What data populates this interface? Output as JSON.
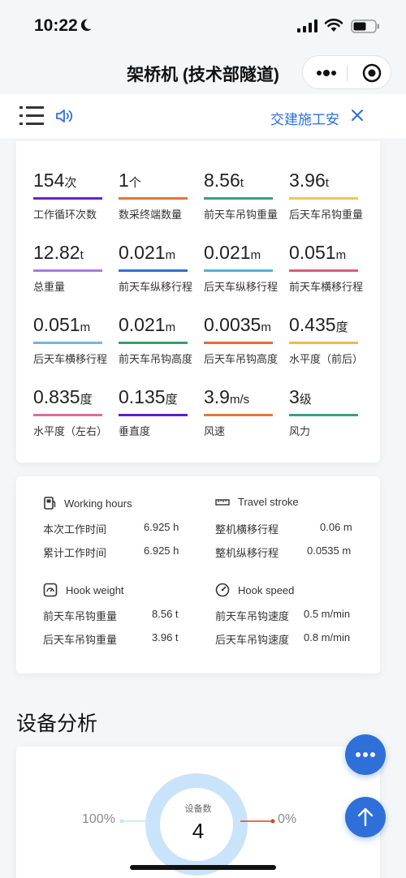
{
  "status_bar": {
    "time": "10:22"
  },
  "nav": {
    "title": "架桥机 (技术部隧道)"
  },
  "notice": {
    "text": "交建施工安"
  },
  "stats": [
    {
      "value": "154",
      "unit": "次",
      "label": "工作循环次数",
      "color": "#6a1fd1"
    },
    {
      "value": "1",
      "unit": "个",
      "label": "数采终端数量",
      "color": "#e0743a"
    },
    {
      "value": "8.56",
      "unit": "t",
      "label": "前天车吊钩重量",
      "color": "#3a9e7e"
    },
    {
      "value": "3.96",
      "unit": "t",
      "label": "后天车吊钩重量",
      "color": "#f2c84b"
    },
    {
      "value": "12.82",
      "unit": "t",
      "label": "总重量",
      "color": "#a77be0"
    },
    {
      "value": "0.021",
      "unit": "m",
      "label": "前天车纵移行程",
      "color": "#2f6fd8"
    },
    {
      "value": "0.021",
      "unit": "m",
      "label": "后天车纵移行程",
      "color": "#4fb3d9"
    },
    {
      "value": "0.051",
      "unit": "m",
      "label": "前天车横移行程",
      "color": "#e05a7a"
    },
    {
      "value": "0.051",
      "unit": "m",
      "label": "后天车横移行程",
      "color": "#6fb7e0"
    },
    {
      "value": "0.021",
      "unit": "m",
      "label": "前天车吊钩高度",
      "color": "#3a9e6a"
    },
    {
      "value": "0.0035",
      "unit": "m",
      "label": "后天车吊钩高度",
      "color": "#e06a3a"
    },
    {
      "value": "0.435",
      "unit": "度",
      "label": "水平度（前后）",
      "color": "#f2b84b"
    },
    {
      "value": "0.835",
      "unit": "度",
      "label": "水平度（左右）",
      "color": "#e06aa0"
    },
    {
      "value": "0.135",
      "unit": "度",
      "label": "垂直度",
      "color": "#5a1fd1"
    },
    {
      "value": "3.9",
      "unit": "m/s",
      "label": "风速",
      "color": "#e07a3a"
    },
    {
      "value": "3",
      "unit": "级",
      "label": "风力",
      "color": "#3aa08a"
    }
  ],
  "info": {
    "working_hours": {
      "title": "Working hours",
      "rows": [
        {
          "label": "本次工作时间",
          "value": "6.925 h"
        },
        {
          "label": "累计工作时间",
          "value": "6.925 h"
        }
      ]
    },
    "travel_stroke": {
      "title": "Travel stroke",
      "rows": [
        {
          "label": "整机横移行程",
          "value": "0.06 m"
        },
        {
          "label": "整机纵移行程",
          "value": "0.0535 m"
        }
      ]
    },
    "hook_weight": {
      "title": "Hook weight",
      "rows": [
        {
          "label": "前天车吊钩重量",
          "value": "8.56 t"
        },
        {
          "label": "后天车吊钩重量",
          "value": "3.96 t"
        }
      ]
    },
    "hook_speed": {
      "title": "Hook speed",
      "rows": [
        {
          "label": "前天车吊钩速度",
          "value": "0.5 m/min"
        },
        {
          "label": "后天车吊钩速度",
          "value": "0.8 m/min"
        }
      ]
    }
  },
  "analysis": {
    "title": "设备分析",
    "donut": {
      "caption": "设备数",
      "count": "4",
      "left_percent": "100%",
      "right_percent": "0%",
      "left_fraction": 1.0,
      "colors": {
        "main": "#c9e4fa",
        "left_dot": "#c9e4fa",
        "right_dot": "#d9412f"
      }
    }
  },
  "theme": {
    "accent": "#2f6fd8"
  }
}
